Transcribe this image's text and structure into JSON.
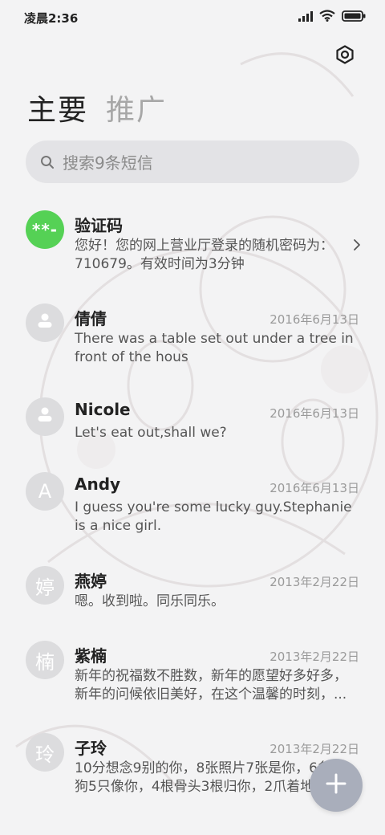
{
  "status_bar": {
    "time": "凌晨2:36"
  },
  "tabs": [
    {
      "label": "主要",
      "active": true
    },
    {
      "label": "推广",
      "active": false
    }
  ],
  "search": {
    "placeholder": "搜索9条短信"
  },
  "conversations": [
    {
      "name": "验证码",
      "avatar": "**-",
      "date": "",
      "preview": "您好！您的网上营业厅登录的随机密码为：710679。有效时间为3分钟",
      "has_chevron": true
    },
    {
      "name": "倩倩",
      "avatar": "person-icon",
      "date": "2016年6月13日",
      "preview": "There was a table set out under a tree in front of the hous"
    },
    {
      "name": "Nicole",
      "avatar": "person-icon",
      "date": "2016年6月13日",
      "preview": "Let's eat out,shall we?"
    },
    {
      "name": "Andy",
      "avatar": "A",
      "date": "2016年6月13日",
      "preview": "I guess you're some lucky guy.Stephanie is a nice girl."
    },
    {
      "name": "燕婷",
      "avatar": "婷",
      "date": "2013年2月22日",
      "preview": "嗯。收到啦。同乐同乐。"
    },
    {
      "name": "紫楠",
      "avatar": "楠",
      "date": "2013年2月22日",
      "preview": "新年的祝福数不胜数，新年的愿望好多好多，新年的问候依旧美好，在这个温馨的时刻，..."
    },
    {
      "name": "子玲",
      "avatar": "玲",
      "date": "2013年2月22日",
      "preview": "10分想念9别的你，8张照片7张是你，6条小狗5只像你，4根骨头3根归你，2爪着地"
    }
  ],
  "colors": {
    "verify_avatar": "#55d155",
    "fab": "#a9aebb"
  }
}
